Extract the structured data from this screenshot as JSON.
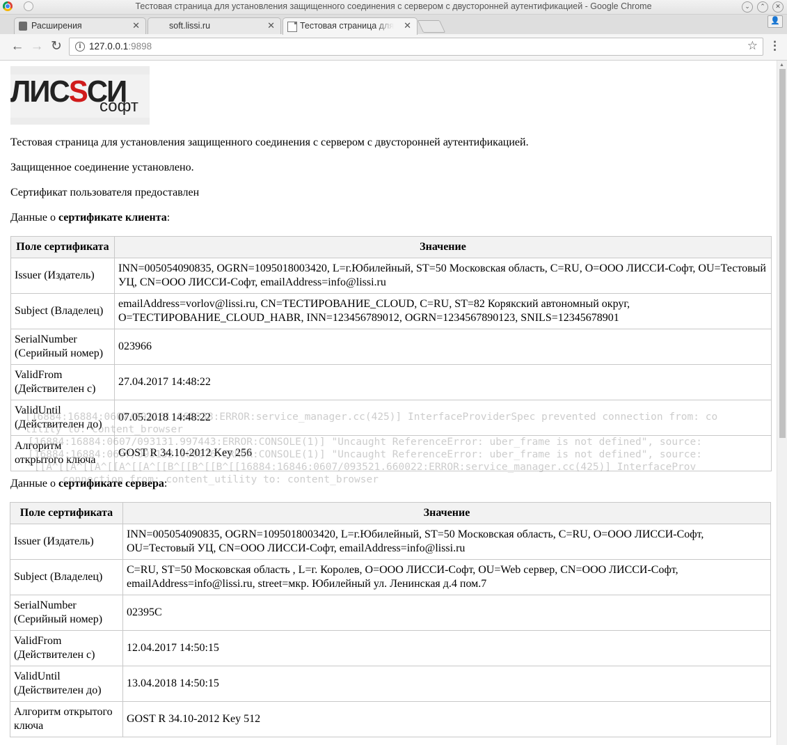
{
  "window": {
    "title": "Тестовая страница для установления защищенного соединения с сервером с двусторонней аутентификацией - Google Chrome"
  },
  "tabs": [
    {
      "label": "Расширения",
      "icon": "puzzle-icon",
      "active": false
    },
    {
      "label": "soft.lissi.ru",
      "icon": "",
      "active": false
    },
    {
      "label": "Тестовая страница для",
      "icon": "document-icon",
      "active": true
    }
  ],
  "toolbar": {
    "url_host": "127.0.0.1",
    "url_port": ":9898"
  },
  "logo": {
    "left": "ЛИС",
    "s": "S",
    "right": "СИ",
    "sub": "софт"
  },
  "page": {
    "heading": "Тестовая страница для установления защищенного соединения с сервером с двусторонней аутентификацией.",
    "status": "Защищенное соединение установлено.",
    "user_cert": "Сертификат пользователя предоставлен",
    "client_prefix": "Данные о ",
    "client_bold": "сертификате клиента",
    "client_suffix": ":",
    "server_prefix": "Данные о ",
    "server_bold": "сертификате сервера",
    "server_suffix": ":"
  },
  "client_table": {
    "headers": [
      "Поле сертификата",
      "Значение"
    ],
    "rows": [
      [
        "Issuer (Издатель)",
        "INN=005054090835, OGRN=1095018003420, L=г.Юбилейный, ST=50 Московская область, C=RU, O=ООО ЛИССИ-Софт, OU=Тестовый УЦ, CN=ООО ЛИССИ-Софт, emailAddress=info@lissi.ru"
      ],
      [
        "Subject (Владелец)",
        "emailAddress=vorlov@lissi.ru, CN=ТЕСТИРОВАНИЕ_CLOUD, C=RU, ST=82 Корякский автономный округ, O=ТЕСТИРОВАНИЕ_CLOUD_HABR, INN=123456789012, OGRN=1234567890123, SNILS=12345678901"
      ],
      [
        "SerialNumber (Серийный номер)",
        "023966"
      ],
      [
        "ValidFrom (Действителен с)",
        "27.04.2017 14:48:22"
      ],
      [
        "ValidUntil (Действителен до)",
        "07.05.2018 14:48:22"
      ],
      [
        "Алгоритм открытого ключа",
        "GOST R 34.10-2012 Key 256"
      ]
    ]
  },
  "server_table": {
    "headers": [
      "Поле сертификата",
      "Значение"
    ],
    "rows": [
      [
        "Issuer (Издатель)",
        "INN=005054090835, OGRN=1095018003420, L=г.Юбилейный, ST=50 Московская область, C=RU, O=ООО ЛИССИ-Софт, OU=Тестовый УЦ, CN=ООО ЛИССИ-Софт, emailAddress=info@lissi.ru"
      ],
      [
        "Subject (Владелец)",
        "C=RU, ST=50 Московская область , L=г. Королев, O=ООО ЛИССИ-Софт, OU=Web сервер, CN=ООО ЛИССИ-Софт, emailAddress=info@lissi.ru, street=мкр. Юбилейный ул. Ленинская д.4 пом.7"
      ],
      [
        "SerialNumber (Серийный номер)",
        "02395C"
      ],
      [
        "ValidFrom (Действителен с)",
        "12.04.2017 14:50:15"
      ],
      [
        "ValidUntil (Действителен до)",
        "13.04.2018 14:50:15"
      ],
      [
        "Алгоритм открытого ключа",
        "GOST R 34.10-2012 Key 512"
      ]
    ]
  },
  "terminal": {
    "lines": [
      "[16884:16884:0607/093131.665338:ERROR:service_manager.cc(425)] InterfaceProviderSpec prevented connection from: co",
      "tility to: content_browser",
      "[16884:16884:0607/093131.997443:ERROR:CONSOLE(1)] \"Uncaught ReferenceError: uber_frame is not defined\", source:",
      "[16884:16884:0607/093132.000676:ERROR:CONSOLE(1)] \"Uncaught ReferenceError: uber_frame is not defined\", source:",
      "^[[A^[[A^[[A^[[A^[[A^[[B^[[B^[[B^[[16884:16846:0607/093521.660022:ERROR:service_manager.cc(425)] InterfaceProv",
      "connection from: content_utility to: content_browser"
    ]
  }
}
